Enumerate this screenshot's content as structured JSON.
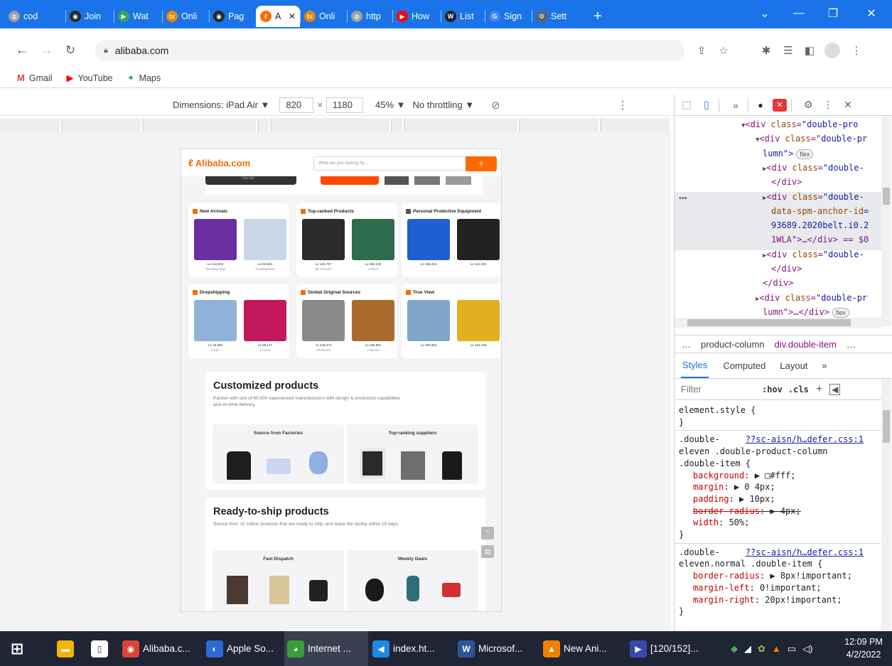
{
  "browser": {
    "tabs": [
      {
        "label": "cod",
        "icon": "generic-globe-icon",
        "color": "#9aa0a6"
      },
      {
        "label": "Join",
        "icon": "github-icon",
        "color": "#24292f"
      },
      {
        "label": "Wat",
        "icon": "play-icon",
        "color": "#34a853"
      },
      {
        "label": "Onli",
        "icon": "tx-icon",
        "color": "#ea8600"
      },
      {
        "label": "Pag",
        "icon": "github-icon",
        "color": "#24292f"
      },
      {
        "label": "A",
        "icon": "alibaba-icon",
        "color": "#ff6a00",
        "active": true
      },
      {
        "label": "Onli",
        "icon": "tx-icon",
        "color": "#ea8600"
      },
      {
        "label": "http",
        "icon": "generic-globe-icon",
        "color": "#9aa0a6"
      },
      {
        "label": "How",
        "icon": "youtube-icon",
        "color": "#ff0000"
      },
      {
        "label": "List",
        "icon": "w-icon",
        "color": "#202124"
      },
      {
        "label": "Sign",
        "icon": "google-icon",
        "color": "#4285f4"
      },
      {
        "label": "Sett",
        "icon": "settings-icon",
        "color": "#5f6368"
      }
    ],
    "new_tab": "+",
    "url": "alibaba.com",
    "bookmarks": [
      {
        "label": "Gmail",
        "icon": "gmail-icon",
        "color": "#ea4335"
      },
      {
        "label": "YouTube",
        "icon": "youtube-icon",
        "color": "#ff0000"
      },
      {
        "label": "Maps",
        "icon": "maps-icon",
        "color": "#34a853"
      }
    ],
    "accent": "#1a73e8"
  },
  "device_toolbar": {
    "dimensions": "Dimensions: iPad Air ▼",
    "width": "820",
    "times": "×",
    "height": "1180",
    "zoom": "45% ▼",
    "throttle": "No throttling ▼"
  },
  "alibaba": {
    "logo": "Alibaba.com",
    "search_placeholder": "What are you looking for...",
    "search_icon": "search-icon",
    "brand_color": "#ff6a00",
    "banner_btn": "Upgrade",
    "cards": [
      {
        "title": "New Arrivals",
        "icon_color": "#ff6a00",
        "items": [
          {
            "price": "Le 144,933",
            "sub": "Trending Now",
            "color": "#6a2fa0"
          },
          {
            "price": "Le 83,683",
            "sub": "Trending Now",
            "color": "#c9d6e8"
          }
        ]
      },
      {
        "title": "Top-ranked Products",
        "icon_color": "#ff6a00",
        "items": [
          {
            "price": "Le 118,797",
            "sub": "50.0 Pieces",
            "color": "#2b2b2b"
          },
          {
            "price": "Le 450,238",
            "sub": "1 Piece",
            "color": "#2e6b4a"
          }
        ]
      },
      {
        "title": "Personal Protective Equipment",
        "icon_color": "#555555",
        "items": [
          {
            "price": "Le 166,315",
            "sub": "",
            "color": "#1f5fd1"
          },
          {
            "price": "Le 114,045",
            "sub": "",
            "color": "#222222"
          }
        ]
      },
      {
        "title": "Dropshipping",
        "icon_color": "#ff6a00",
        "items": [
          {
            "price": "Le 49,895",
            "sub": "1 Pair",
            "color": "#8fb3d9"
          },
          {
            "price": "Le 85,177",
            "sub": "1 Piece",
            "color": "#c2185b"
          }
        ]
      },
      {
        "title": "Global Original Sources",
        "icon_color": "#ff6a00",
        "items": [
          {
            "price": "Le 249,473",
            "sub": "50 Pieces",
            "color": "#8a8a8a"
          },
          {
            "price": "Le 336,981",
            "sub": "2 Pieces",
            "color": "#a86b2d"
          }
        ]
      },
      {
        "title": "True View",
        "icon_color": "#ff6a00",
        "items": [
          {
            "price": "Le 290,952",
            "sub": "",
            "color": "#7fa6c9"
          },
          {
            "price": "Le 154,436",
            "sub": "",
            "color": "#e0b020"
          }
        ]
      }
    ],
    "customized": {
      "title": "Customized products",
      "desc_line1": "Partner with one of 60,000 experienced manufacturers with design & production capabilities",
      "desc_line2": "and on-time delivery.",
      "sub_left": "Source from Factories",
      "sub_right": "Top-ranking suppliers"
    },
    "ready": {
      "title": "Ready-to-ship products",
      "desc": "Source from 15 million products that are ready to ship, and leave the facility within 15 days.",
      "sub_left": "Fast Dispatch",
      "sub_right": "Weekly Deals"
    }
  },
  "devtools": {
    "dom": [
      {
        "indent": 94,
        "arrow": "▼",
        "tag": "<div ",
        "attr": "class",
        "val": "\"double-pro"
      },
      {
        "indent": 114,
        "arrow": "▼",
        "tag": "<div ",
        "attr": "class",
        "val": "\"double-pr"
      },
      {
        "indent": 124,
        "arrow": "",
        "tag": "",
        "attr": "",
        "val": "lumn\">",
        "badge": "flex"
      },
      {
        "indent": 124,
        "arrow": "▶",
        "tag": "<div ",
        "attr": "class",
        "val": "\"double-"
      },
      {
        "indent": 136,
        "arrow": "",
        "tag": "</div>",
        "attr": "",
        "val": ""
      },
      {
        "indent": 124,
        "arrow": "▶",
        "tag": "<div ",
        "attr": "class",
        "val": "\"double-"
      },
      {
        "indent": 136,
        "arrow": "",
        "tag": "",
        "attr": "data-spm-anchor-id",
        "val": "="
      },
      {
        "indent": 136,
        "arrow": "",
        "tag": "",
        "attr": "",
        "val": "93689.2020belt.i0.2"
      },
      {
        "indent": 136,
        "arrow": "",
        "tag": "",
        "attr": "",
        "val": "1WLA\">…</div> == $0"
      },
      {
        "indent": 124,
        "arrow": "▶",
        "tag": "<div ",
        "attr": "class",
        "val": "\"double-"
      },
      {
        "indent": 136,
        "arrow": "",
        "tag": "</div>",
        "attr": "",
        "val": ""
      },
      {
        "indent": 124,
        "arrow": "",
        "tag": "</div>",
        "attr": "",
        "val": ""
      },
      {
        "indent": 114,
        "arrow": "▶",
        "tag": "<div ",
        "attr": "class",
        "val": "\"double-pr"
      },
      {
        "indent": 124,
        "arrow": "",
        "tag": "",
        "attr": "",
        "val": "lumn\">…</div>",
        "badge": "flex"
      }
    ],
    "crumbs": [
      "…",
      "product-column",
      "div.double-item",
      "…"
    ],
    "tabs": [
      "Styles",
      "Computed",
      "Layout",
      "»"
    ],
    "filter": "Filter",
    "hov": ":hov",
    "cls": ".cls",
    "rules": [
      {
        "t": "sel",
        "text": "element.style {"
      },
      {
        "t": "plain",
        "text": "}"
      },
      {
        "t": "sep"
      },
      {
        "t": "selsrc",
        "text": ".double-",
        "src": "??sc-aisn/h…defer.css:1"
      },
      {
        "t": "plain",
        "text": "eleven .double-product-column"
      },
      {
        "t": "plain",
        "text": ".double-item {"
      },
      {
        "t": "prop",
        "name": "background",
        "value": "▶ □#fff;"
      },
      {
        "t": "prop",
        "name": "margin",
        "value": "▶ 0 4px;"
      },
      {
        "t": "prop",
        "name": "padding",
        "value": "▶ 10px;"
      },
      {
        "t": "strike",
        "name": "border-radius",
        "value": "▶ 4px;"
      },
      {
        "t": "prop",
        "name": "width",
        "value": "50%;"
      },
      {
        "t": "plain",
        "text": "}"
      },
      {
        "t": "sep"
      },
      {
        "t": "selsrc",
        "text": ".double-",
        "src": "??sc-aisn/h…defer.css:1"
      },
      {
        "t": "plain",
        "text": "eleven.normal .double-item {"
      },
      {
        "t": "prop",
        "name": "border-radius",
        "value": "▶ 8px!important;"
      },
      {
        "t": "prop",
        "name": "margin-left",
        "value": "0!important;"
      },
      {
        "t": "prop",
        "name": "margin-right",
        "value": "20px!important;"
      },
      {
        "t": "plain",
        "text": "}"
      }
    ]
  },
  "taskbar": {
    "apps": [
      {
        "label": "",
        "icon": "windows-start-icon",
        "color": "#1f2535"
      },
      {
        "label": "",
        "icon": "file-explorer-icon",
        "color": "#f5b400"
      },
      {
        "label": "",
        "icon": "document-icon",
        "color": "#ffffff"
      },
      {
        "label": "Alibaba.c...",
        "icon": "chrome-icon",
        "color": "#db4437",
        "open": true
      },
      {
        "label": "Apple So...",
        "icon": "apple-software-icon",
        "color": "#2d6bd4",
        "open": true
      },
      {
        "label": "Internet ...",
        "icon": "internet-icon",
        "color": "#3a9d3a",
        "open": true
      },
      {
        "label": "index.ht...",
        "icon": "vscode-icon",
        "color": "#1e88e5",
        "open": true
      },
      {
        "label": "Microsof...",
        "icon": "word-icon",
        "color": "#2b579a",
        "open": true
      },
      {
        "label": "New Ani...",
        "icon": "vlc-icon",
        "color": "#f08000",
        "open": true
      },
      {
        "label": "[120/152]...",
        "icon": "media-icon",
        "color": "#3949ab",
        "open": true
      }
    ],
    "time": "12:09 PM",
    "date": "4/2/2022"
  }
}
